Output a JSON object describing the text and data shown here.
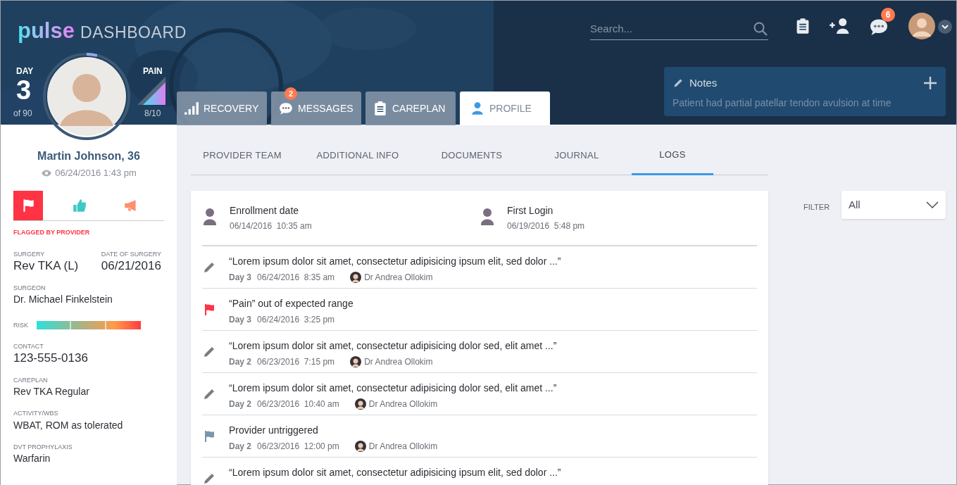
{
  "header": {
    "brand": "pulse",
    "title": "DASHBOARD",
    "search": {
      "placeholder": "Search..."
    },
    "messages_badge": "6"
  },
  "patient": {
    "day_label": "DAY",
    "day": "3",
    "day_total": "of 90",
    "day_progress": {
      "level": 0.04
    },
    "pain_label": "PAIN",
    "pain": "8/10",
    "pain_meter": {
      "level": 0.8
    }
  },
  "nav_tabs": [
    {
      "label": "RECOVERY",
      "kind": "bars",
      "selected": false
    },
    {
      "label": "MESSAGES",
      "kind": "chat",
      "badge": "2",
      "selected": false
    },
    {
      "label": "CAREPLAN",
      "kind": "clipboard",
      "selected": false
    },
    {
      "label": "PROFILE",
      "kind": "person",
      "selected": true
    }
  ],
  "notes": {
    "title": "Notes",
    "text": "Patient had partial patellar tendon avulsion at time"
  },
  "sidebar": {
    "name": "Martin Johnson, 36",
    "viewed": "06/24/2016 1:43 pm",
    "status_buttons": [
      {
        "kind": "flag",
        "selected": true
      },
      {
        "kind": "thumb",
        "selected": false
      },
      {
        "kind": "megaphone",
        "selected": false
      }
    ],
    "status_label": "FLAGGED BY PROVIDER",
    "info": [
      {
        "kind": "pair",
        "items": [
          {
            "label": "SURGERY",
            "value": "Rev TKA (L)"
          },
          {
            "label": "DATE OF SURGERY",
            "value": "06/21/2016"
          }
        ]
      },
      {
        "kind": "field",
        "label": "SURGEON",
        "value": "Dr. Michael Finkelstein"
      },
      {
        "kind": "risk",
        "label": "RISK"
      },
      {
        "kind": "large_field",
        "label": "CONTACT",
        "value": "123-555-0136"
      },
      {
        "kind": "field",
        "label": "CAREPLAN",
        "value": "Rev TKA Regular"
      },
      {
        "kind": "field",
        "label": "ACTIVITY/WBS",
        "value": "WBAT, ROM as tolerated"
      },
      {
        "kind": "field",
        "label": "DVT PROPHYLAXIS",
        "value": "Warfarin"
      }
    ]
  },
  "sub_tabs": [
    {
      "label": "PROVIDER TEAM",
      "selected": false
    },
    {
      "label": "ADDITIONAL INFO",
      "selected": false
    },
    {
      "label": "DOCUMENTS",
      "selected": false
    },
    {
      "label": "JOURNAL",
      "selected": false
    },
    {
      "label": "LOGS",
      "selected": true
    }
  ],
  "filter": {
    "label": "FILTER",
    "value": "All"
  },
  "log_summary": [
    {
      "title": "Enrollment date",
      "date": "06/14/2016",
      "time": "10:35 am"
    },
    {
      "title": "First Login",
      "date": "06/19/2016",
      "time": "5:48 pm"
    }
  ],
  "logs": [
    {
      "kind": "note",
      "text": "“Lorem ipsum dolor sit amet, consectetur adipisicing ipsum elit, sed dolor ...”",
      "day": "Day 3",
      "date": "06/24/2016",
      "time": "8:35 am",
      "author": "Dr Andrea Ollokim"
    },
    {
      "kind": "flag",
      "text": "“Pain” out of expected range",
      "day": "Day 3",
      "date": "06/24/2016",
      "time": "3:25 pm"
    },
    {
      "kind": "note",
      "text": "“Lorem ipsum dolor sit amet, consectetur adipisicing dolor sed, elit amet ...”",
      "day": "Day 2",
      "date": "06/23/2016",
      "time": "7:15 pm",
      "author": "Dr Andrea Ollokim"
    },
    {
      "kind": "note",
      "text": "“Lorem ipsum dolor sit amet, consectetur adipisicing dolor sed, elit amet ...”",
      "day": "Day 2",
      "date": "06/23/2016",
      "time": "10:40 am",
      "author": "Dr Andrea Ollokim"
    },
    {
      "kind": "provider_flag",
      "text": "Provider untriggered",
      "day": "Day 2",
      "date": "06/23/2016",
      "time": "12:00 pm",
      "author": "Dr Andrea Ollokim"
    },
    {
      "kind": "note",
      "text": "“Lorem ipsum dolor sit amet, consectetur adipisicing ipsum elit, sed dolor ...”"
    }
  ]
}
